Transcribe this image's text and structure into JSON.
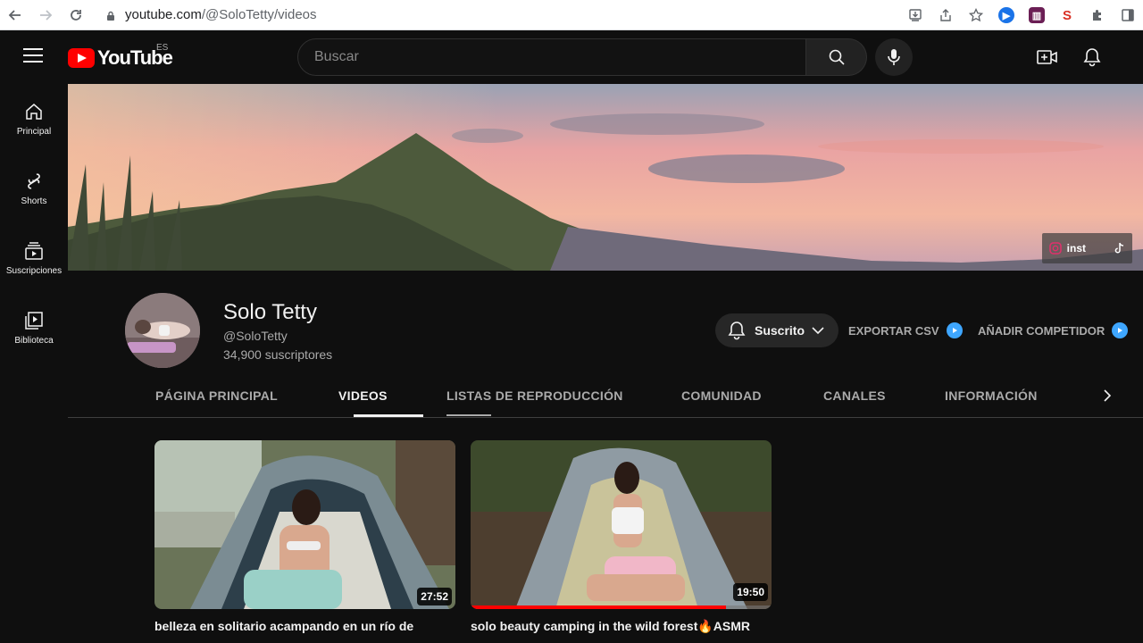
{
  "browser": {
    "url_host": "youtube.com",
    "url_path": "/@SoloTetty/videos"
  },
  "masthead": {
    "logo_text": "YouTube",
    "region": "ES",
    "search_placeholder": "Buscar"
  },
  "guide": {
    "items": [
      {
        "label": "Principal",
        "icon": "home-icon"
      },
      {
        "label": "Shorts",
        "icon": "shorts-icon"
      },
      {
        "label": "Suscripciones",
        "icon": "subscriptions-icon"
      },
      {
        "label": "Biblioteca",
        "icon": "library-icon"
      }
    ]
  },
  "banner": {
    "link_label": "inst"
  },
  "channel": {
    "name": "Solo Tetty",
    "handle": "@SoloTetty",
    "subscribers": "34,900 suscriptores",
    "subscribe_label": "Suscrito",
    "export_label": "EXPORTAR CSV",
    "competitor_label": "AÑADIR COMPETIDOR"
  },
  "tabs": [
    {
      "label": "PÁGINA PRINCIPAL",
      "active": false
    },
    {
      "label": "VIDEOS",
      "active": true
    },
    {
      "label": "LISTAS DE REPRODUCCIÓN",
      "active": false
    },
    {
      "label": "COMUNIDAD",
      "active": false
    },
    {
      "label": "CANALES",
      "active": false
    },
    {
      "label": "INFORMACIÓN",
      "active": false
    }
  ],
  "videos": [
    {
      "title": "belleza en solitario acampando en un río de",
      "duration": "27:52",
      "watched_fraction": 0
    },
    {
      "title": "solo beauty camping in the wild forest🔥ASMR",
      "duration": "19:50",
      "watched_fraction": 0.85
    }
  ],
  "colors": {
    "accent_red": "#ff0000",
    "ext_blue": "#3ea6ff"
  }
}
